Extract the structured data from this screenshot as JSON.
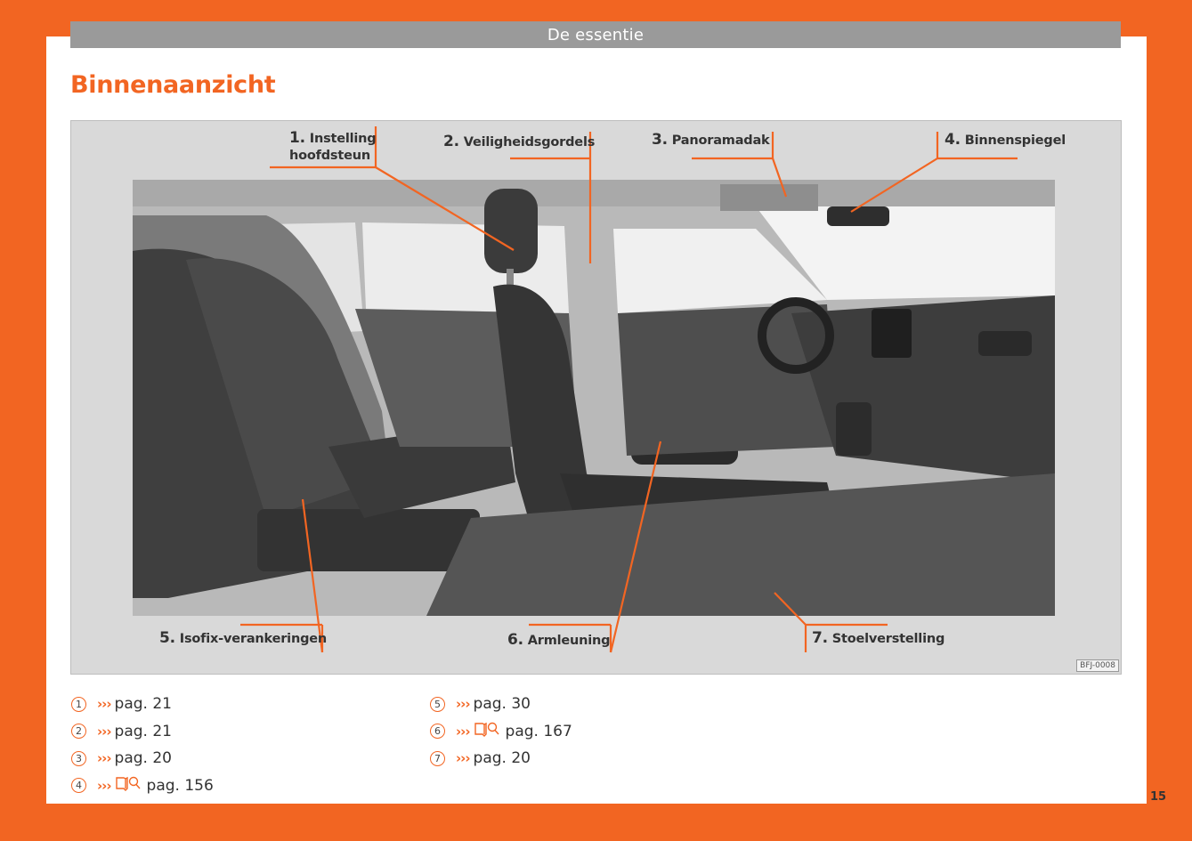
{
  "header": {
    "section": "De essentie"
  },
  "title": "Binnenaanzicht",
  "figure": {
    "code": "BFJ-0008",
    "labels": [
      {
        "num": "1.",
        "text": "Instelling",
        "text2": "hoofdsteun"
      },
      {
        "num": "2.",
        "text": "Veiligheidsgordels"
      },
      {
        "num": "3.",
        "text": "Panoramadak"
      },
      {
        "num": "4.",
        "text": "Binnenspiegel"
      },
      {
        "num": "5.",
        "text": "Isofix-verankeringen"
      },
      {
        "num": "6.",
        "text": "Armleuning"
      },
      {
        "num": "7.",
        "text": "Stoelverstelling"
      }
    ]
  },
  "refs": [
    {
      "n": "1",
      "arrows": "›››",
      "page": "pag. 21"
    },
    {
      "n": "2",
      "arrows": "›››",
      "page": "pag. 21"
    },
    {
      "n": "3",
      "arrows": "›››",
      "page": "pag. 20"
    },
    {
      "n": "4",
      "arrows": "›››",
      "page": "pag. 156"
    },
    {
      "n": "5",
      "arrows": "›››",
      "page": "pag. 30"
    },
    {
      "n": "6",
      "arrows": "›››",
      "page": "pag. 167"
    },
    {
      "n": "7",
      "arrows": "›››",
      "page": "pag. 20"
    }
  ],
  "page_number": "15",
  "icons": {
    "book": "book-search-icon"
  },
  "colors": {
    "accent": "#f26522",
    "bar": "#9a9a9a"
  }
}
